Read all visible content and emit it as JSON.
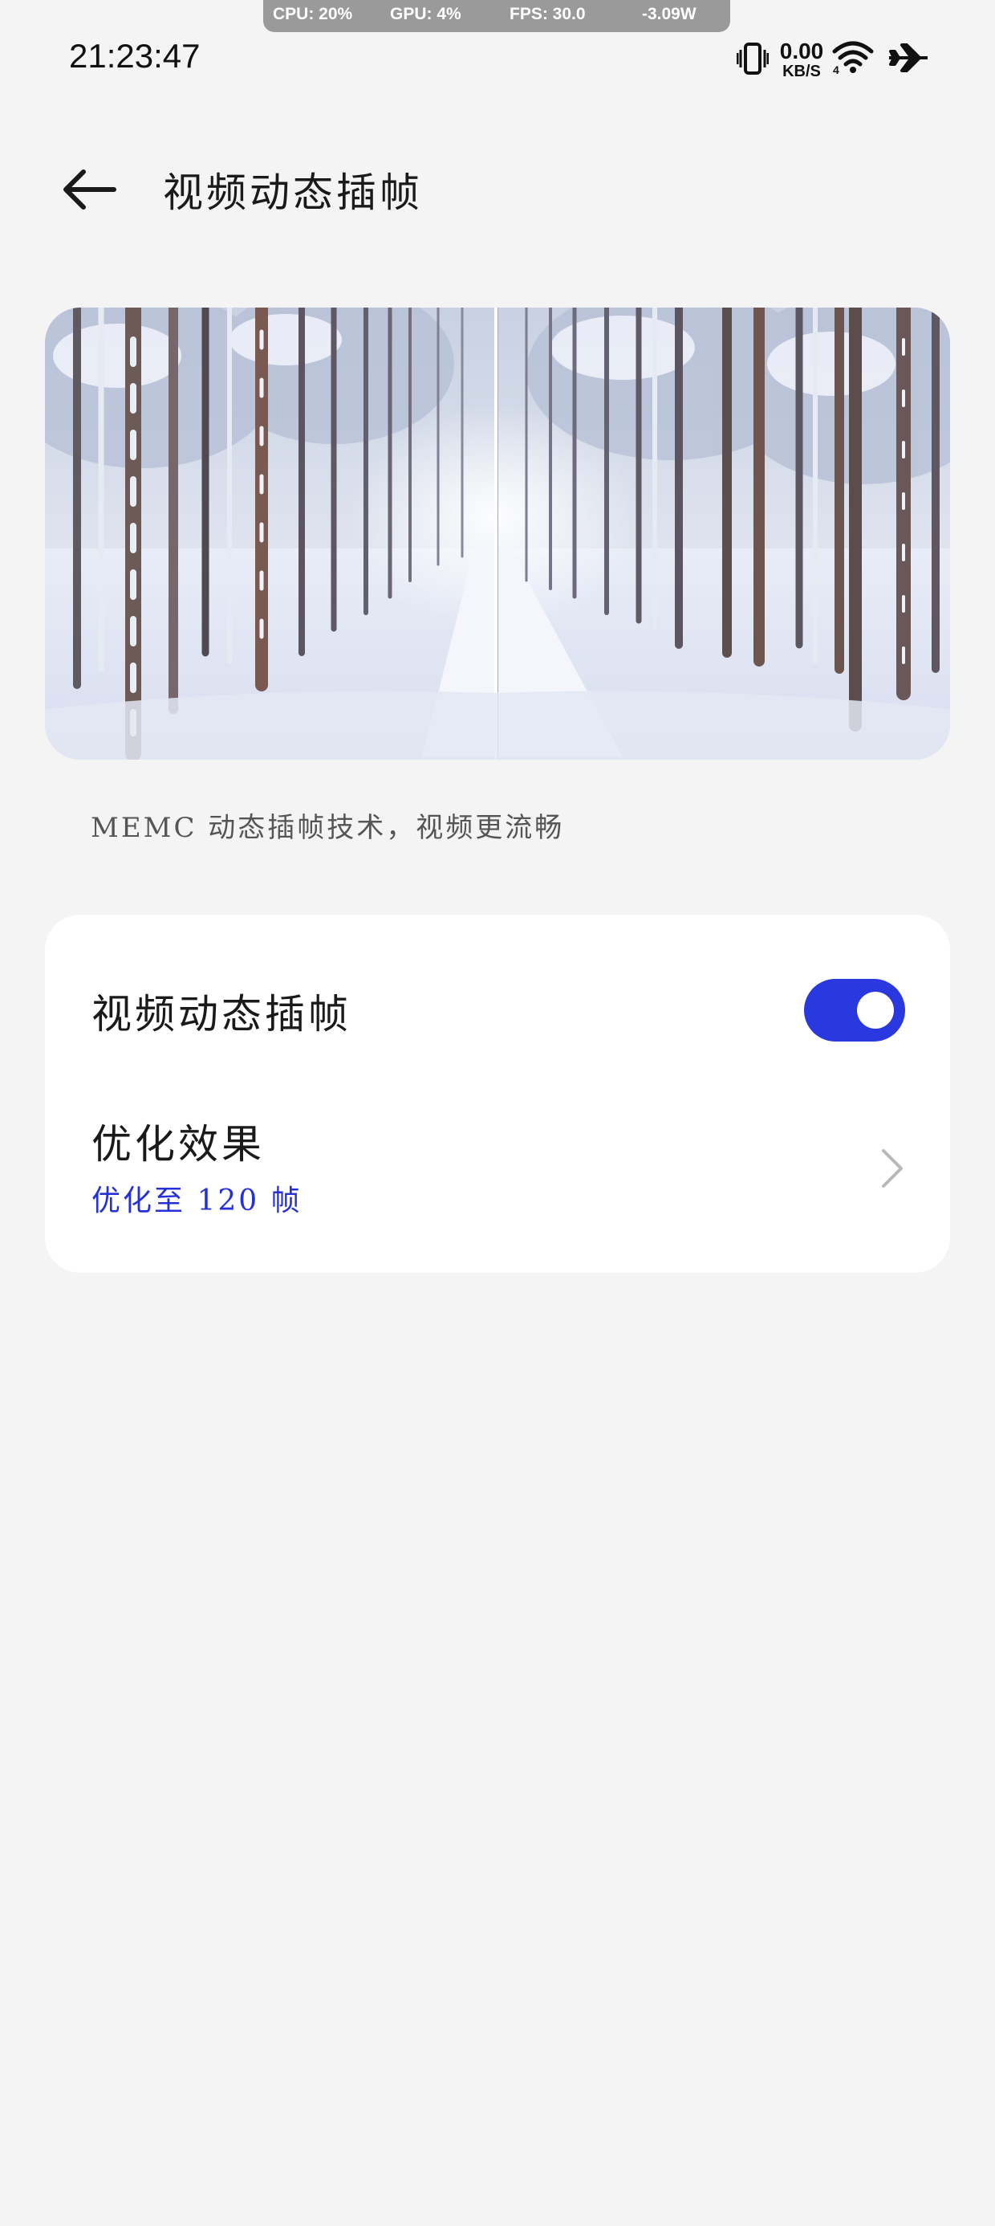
{
  "perf_overlay": {
    "cpu": "CPU: 20%",
    "gpu": "GPU: 4%",
    "fps": "FPS: 30.0",
    "power": "-3.09W"
  },
  "status_bar": {
    "time": "21:23:47",
    "net_speed_value": "0.00",
    "net_speed_unit": "KB/S",
    "icons": [
      "vibrate-icon",
      "wifi-icon",
      "airplane-mode-icon"
    ]
  },
  "header": {
    "title": "视频动态插帧",
    "back_icon": "arrow-left-icon"
  },
  "preview": {
    "caption": "MEMC 动态插帧技术，视频更流畅"
  },
  "settings": {
    "toggle_label": "视频动态插帧",
    "toggle_on": true,
    "option_label": "优化效果",
    "option_value": "优化至 120 帧",
    "chevron_icon": "chevron-right-icon"
  },
  "colors": {
    "accent": "#2a38e0",
    "link": "#2630d8",
    "background": "#f4f4f4",
    "card": "#ffffff"
  }
}
